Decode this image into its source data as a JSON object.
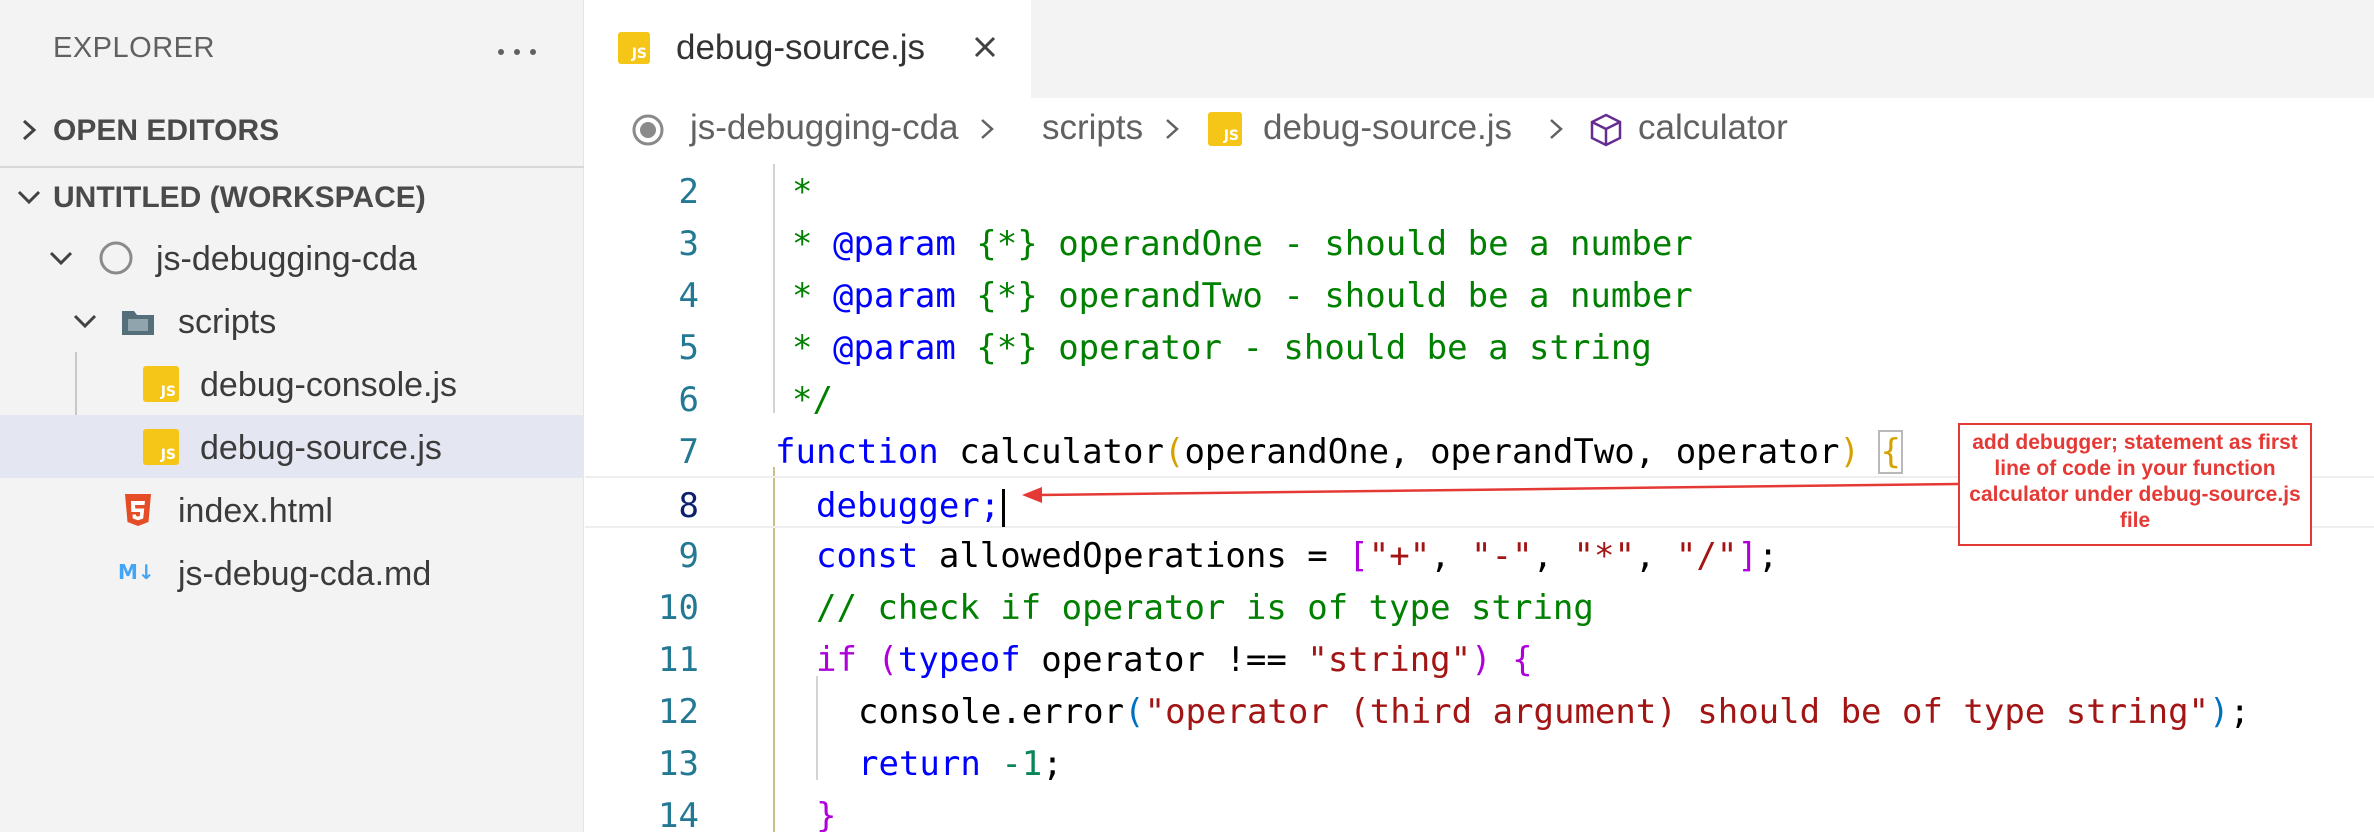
{
  "sidebar": {
    "explorer_title": "EXPLORER",
    "sections": {
      "open_editors": "OPEN EDITORS",
      "workspace": "UNTITLED (WORKSPACE)"
    },
    "tree": [
      {
        "label": "js-debugging-cda",
        "icon": "folder-circle-icon"
      },
      {
        "label": "scripts",
        "icon": "folder-icon"
      },
      {
        "label": "debug-console.js",
        "icon": "js-file-icon"
      },
      {
        "label": "debug-source.js",
        "icon": "js-file-icon",
        "selected": true
      },
      {
        "label": "index.html",
        "icon": "html5-file-icon"
      },
      {
        "label": "js-debug-cda.md",
        "icon": "markdown-file-icon"
      }
    ],
    "js_badge": "JS",
    "md_badge": "M↓"
  },
  "tab": {
    "label": "debug-source.js"
  },
  "breadcrumb": {
    "items": [
      "js-debugging-cda",
      "scripts",
      "debug-source.js",
      "calculator"
    ]
  },
  "code": {
    "lines": [
      {
        "num": "2"
      },
      {
        "num": "3"
      },
      {
        "num": "4"
      },
      {
        "num": "5"
      },
      {
        "num": "6"
      },
      {
        "num": "7"
      },
      {
        "num": "8"
      },
      {
        "num": "9"
      },
      {
        "num": "10"
      },
      {
        "num": "11"
      },
      {
        "num": "12"
      },
      {
        "num": "13"
      },
      {
        "num": "14"
      }
    ],
    "tokens": {
      "star": "*",
      "param": "@param",
      "any_type": "{*}",
      "p1_name": "operandOne",
      "p1_desc": "- should be a number",
      "p2_name": "operandTwo",
      "p2_desc": "- should be a number",
      "p3_name": "operator",
      "p3_desc": "- should be a string",
      "doc_close": "*/",
      "function_kw": "function",
      "fn_name": "calculator",
      "open_paren": "(",
      "params": "operandOne, operandTwo, operator",
      "close_paren": ")",
      "open_brace": "{",
      "debugger_stmt": "debugger;",
      "const_kw": "const",
      "allowed_decl": "allowedOperations =",
      "open_bracket": "[",
      "op_plus": "\"+\"",
      "op_minus": "\"-\"",
      "op_mult": "\"*\"",
      "op_div": "\"/\"",
      "comma": ",",
      "close_bracket": "]",
      "semicolon": ";",
      "line10_comment": "// check if operator is of type string",
      "if_kw": "if",
      "typeof_kw": "typeof",
      "typeof_expr": "operator !==",
      "string_lit": "\"string\"",
      "console_call": "console.error",
      "error_msg": "\"operator (third argument) should be of type string\"",
      "return_kw": "return",
      "neg_one": "-1",
      "close_brace": "}"
    }
  },
  "annotation": {
    "text": "add debugger; statement as first line of code in your function calculator under debug-source.js file",
    "color": "#e53935"
  }
}
